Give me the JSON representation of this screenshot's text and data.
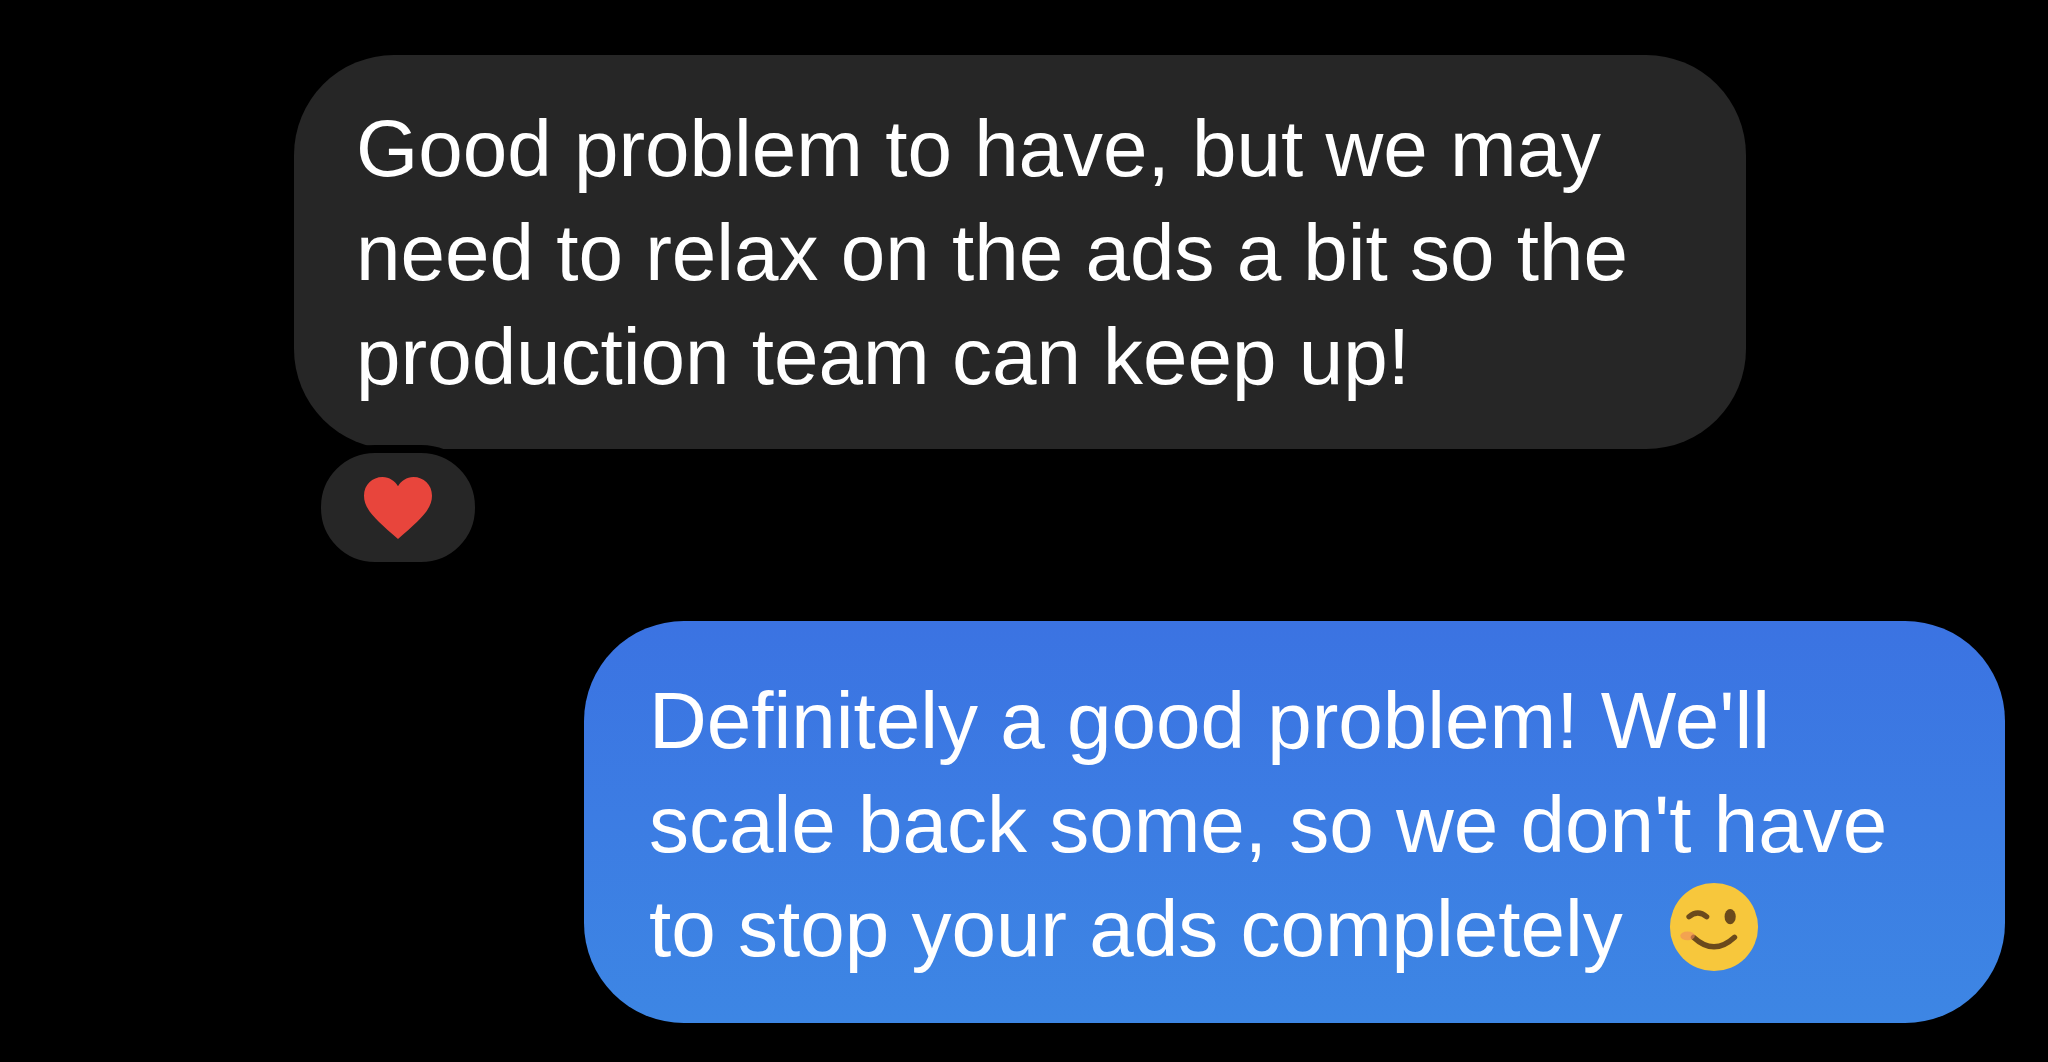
{
  "messages": [
    {
      "kind": "incoming",
      "text": "Good problem to have, but we may need to relax on the ads a bit so the production team can keep up!",
      "heart_reaction": true
    },
    {
      "kind": "outgoing",
      "text": "Definitely a good problem! We'll scale back some, so we don't have to stop your ads completely",
      "wink_emoji": true
    }
  ]
}
